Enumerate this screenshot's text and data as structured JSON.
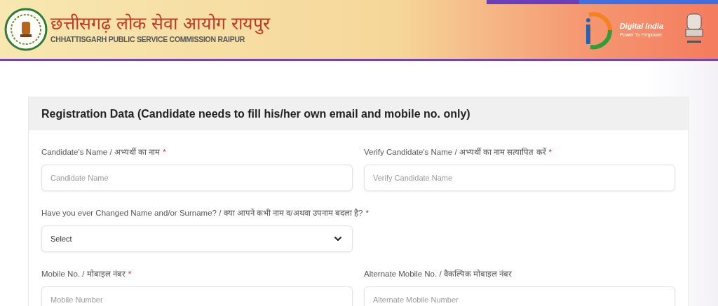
{
  "header": {
    "title_hindi": "छत्तीसगढ़ लोक सेवा आयोग रायपुर",
    "title_english": "CHHATTISGARH PUBLIC SERVICE COMMISSION RAIPUR",
    "digital_india": {
      "name": "Digital India",
      "tagline": "Power To Empower"
    }
  },
  "card": {
    "title": "Registration Data (Candidate needs to fill his/her own email and mobile no. only)",
    "rows": [
      [
        {
          "kind": "input",
          "label": "Candidate's Name / अभ्यर्थी का नाम",
          "required_mark": "*",
          "placeholder": "Candidate Name"
        },
        {
          "kind": "input",
          "label": "Verify Candidate's Name / अभ्यर्थी का नाम सत्यापित करें",
          "required_mark": "*",
          "placeholder": "Verify Candidate Name"
        }
      ],
      [
        {
          "kind": "select",
          "label": "Have you ever Changed Name and/or Surname? / क्या आपने कभी नाम व/अथवा उपनाम बदला है?",
          "required_mark": "*",
          "value": "Select"
        }
      ],
      [
        {
          "kind": "input",
          "label": "Mobile No. / मोबाइल नंबर",
          "required_mark": "*",
          "placeholder": "Mobile Number"
        },
        {
          "kind": "input",
          "label": "Alternate Mobile No. / वैकल्पिक मोबाइल नंबर",
          "placeholder": "Alternate Mobile Number"
        }
      ]
    ]
  }
}
